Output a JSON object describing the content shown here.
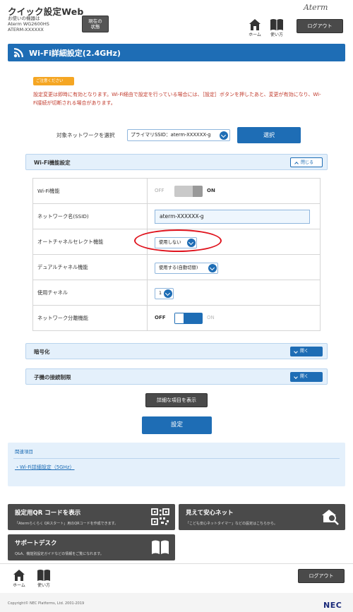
{
  "header": {
    "app_title": "クイック設定Web",
    "model_label": "お使いの機器は",
    "model_name": "Aterm WG2600HS",
    "device_id": "ATERM-XXXXXX",
    "state_button_line1": "現在の",
    "state_button_line2": "状態",
    "logo": "Aterm",
    "home_label": "ホーム",
    "help_label": "使い方",
    "logout_label": "ログアウト"
  },
  "page": {
    "title": "Wi-Fi詳細設定(2.4GHz)"
  },
  "notice": {
    "badge": "ご注意ください",
    "text": "設定変更は即時に有効となります。Wi-Fi経由で設定を行っている場合には、［設定］ボタンを押したあと、変更が有効になり、Wi-Fi接続が切断される場合があります。"
  },
  "target_network": {
    "label": "対象ネットワークを選択",
    "selected": "プライマリSSID：aterm-XXXXXX-g",
    "select_button": "選択"
  },
  "wifi_function": {
    "section_title": "Wi-Fi機能設定",
    "toggle_label": "閉じる",
    "rows": {
      "wifi": {
        "label": "Wi-Fi機能",
        "off": "OFF",
        "on": "ON",
        "state": "ON"
      },
      "ssid": {
        "label": "ネットワーク名(SSID)",
        "value": "aterm-XXXXXX-g"
      },
      "auto_channel": {
        "label": "オートチャネルセレクト機能",
        "value": "使用しない"
      },
      "dual_channel": {
        "label": "デュアルチャネル機能",
        "value": "使用する(自動切替)"
      },
      "channel": {
        "label": "使用チャネル",
        "value": "1"
      },
      "separation": {
        "label": "ネットワーク分離機能",
        "off": "OFF",
        "on": "ON",
        "state": "OFF"
      }
    }
  },
  "encryption": {
    "section_title": "暗号化",
    "toggle_label": "開く"
  },
  "mac_filter": {
    "section_title": "子機の接続制限",
    "toggle_label": "開く"
  },
  "buttons": {
    "advanced": "詳細な項目を表示",
    "submit": "設定"
  },
  "related": {
    "title": "関連項目",
    "link": "Wi-Fi詳細設定（5GHz）"
  },
  "tiles": {
    "qr": {
      "title": "設定用QR コードを表示",
      "desc": "「Atermらくらく QRスタート」用のQRコードを作成できます。"
    },
    "safety": {
      "title": "見えて安心ネット",
      "desc": "「こども安心ネットタイマー」などの設定はこちらから。"
    },
    "support": {
      "title": "サポートデスク",
      "desc": "Q&A、機能別設定ガイドなどの情報をご覧になれます。"
    }
  },
  "footer": {
    "home_label": "ホーム",
    "help_label": "使い方",
    "logout_label": "ログアウト",
    "copyright": "Copyright© NEC Platforms, Ltd. 2001-2019",
    "brand": "NEC"
  },
  "colors": {
    "accent": "#1e6db5",
    "section_bg": "#e4f0fb",
    "notice_text": "#c0392b",
    "highlight": "#e0141e"
  }
}
